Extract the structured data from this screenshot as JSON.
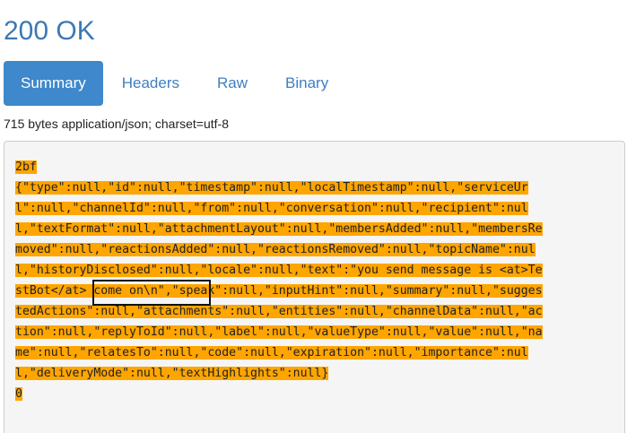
{
  "status": "200 OK",
  "tabs": [
    {
      "label": "Summary",
      "active": true
    },
    {
      "label": "Headers",
      "active": false
    },
    {
      "label": "Raw",
      "active": false
    },
    {
      "label": "Binary",
      "active": false
    }
  ],
  "content_info": "715 bytes application/json; charset=utf-8",
  "response_body": {
    "lines": [
      "2bf",
      "{\"type\":null,\"id\":null,\"timestamp\":null,\"localTimestamp\":null,\"serviceUr",
      "l\":null,\"channelId\":null,\"from\":null,\"conversation\":null,\"recipient\":nul",
      "l,\"textFormat\":null,\"attachmentLayout\":null,\"membersAdded\":null,\"membersRe",
      "moved\":null,\"reactionsAdded\":null,\"reactionsRemoved\":null,\"topicName\":nul",
      "l,\"historyDisclosed\":null,\"locale\":null,\"text\":\"you send message is <at>Te",
      "stBot</at> come on\\n\",\"speak\":null,\"inputHint\":null,\"summary\":null,\"sugges",
      "tedActions\":null,\"attachments\":null,\"entities\":null,\"channelData\":null,\"ac",
      "tion\":null,\"replyToId\":null,\"label\":null,\"valueType\":null,\"value\":null,\"na",
      "me\":null,\"relatesTo\":null,\"code\":null,\"expiration\":null,\"importance\":nul",
      "l,\"deliveryMode\":null,\"textHighlights\":null}",
      "0"
    ],
    "highlight_color": "#ffa500"
  },
  "colors": {
    "accent": "#3e88cb",
    "link": "#3f7fc0",
    "title": "#3a78b4"
  }
}
